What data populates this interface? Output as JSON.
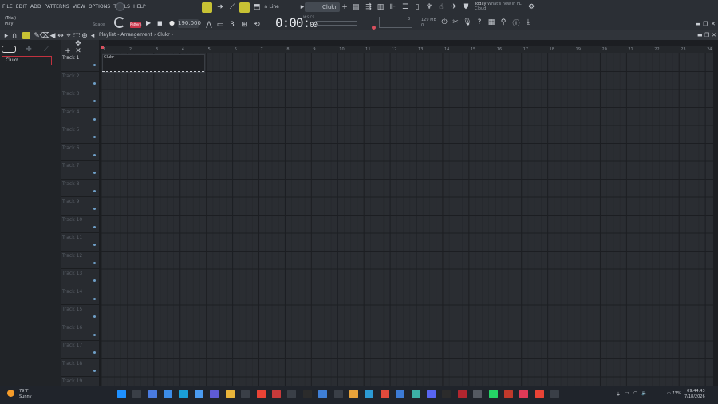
{
  "menu": [
    "FILE",
    "EDIT",
    "ADD",
    "PATTERNS",
    "VIEW",
    "OPTIONS",
    "TOOLS",
    "HELP"
  ],
  "hint": {
    "line1": "(Trial)",
    "line2": "Play"
  },
  "space_label": "Space",
  "pattern_button": "Pattern",
  "tempo": "190.000",
  "time": {
    "main": "0:00:",
    "sub": "00",
    "label": "M:S:CS"
  },
  "snap": {
    "icon": "magnet-icon",
    "label": "Line"
  },
  "pattern_name": "Clukr",
  "cpu": {
    "voices": "3",
    "memory": "129 MB",
    "cpu": "0"
  },
  "news": {
    "when": "Today",
    "title": "What's new in FL",
    "sub": "Cloud"
  },
  "breadcrumb": "Playlist - Arrangement › Clukr ›",
  "browser": {
    "selected_pattern": "Clukr"
  },
  "ruler": [
    "1",
    "2",
    "3",
    "4",
    "5",
    "6",
    "7",
    "8",
    "9",
    "10",
    "11",
    "12",
    "13",
    "14",
    "15",
    "16",
    "17",
    "18",
    "19",
    "20",
    "21",
    "22",
    "23",
    "24"
  ],
  "clip_label": "Clukr",
  "tracks": [
    "Track 1",
    "Track 2",
    "Track 3",
    "Track 4",
    "Track 5",
    "Track 6",
    "Track 7",
    "Track 8",
    "Track 9",
    "Track 10",
    "Track 11",
    "Track 12",
    "Track 13",
    "Track 14",
    "Track 15",
    "Track 16",
    "Track 17",
    "Track 18",
    "Track 19"
  ],
  "weather": {
    "temp": "79°F",
    "desc": "Sunny"
  },
  "battery": "73%",
  "clock": {
    "time": "09:44:43",
    "date": "7/18/2026"
  },
  "colors": {
    "accent": "#c7c234",
    "record": "#c9344a",
    "selection": "#c2323f"
  },
  "taskbar_icons": [
    "windows-icon",
    "search-icon",
    "task-view-icon",
    "widgets-icon",
    "edge-icon",
    "copilot-icon",
    "teams-icon",
    "file-explorer-icon",
    "store-icon",
    "chrome-icon",
    "app-icon",
    "app-icon",
    "notion-icon",
    "photos-icon",
    "media-icon",
    "fl-studio-icon",
    "app-icon",
    "figma-icon",
    "app-icon",
    "app-icon",
    "discord-icon",
    "app-icon",
    "app-icon",
    "camera-icon",
    "whatsapp-icon",
    "app-icon",
    "app-icon",
    "chrome-icon",
    "app-icon"
  ]
}
